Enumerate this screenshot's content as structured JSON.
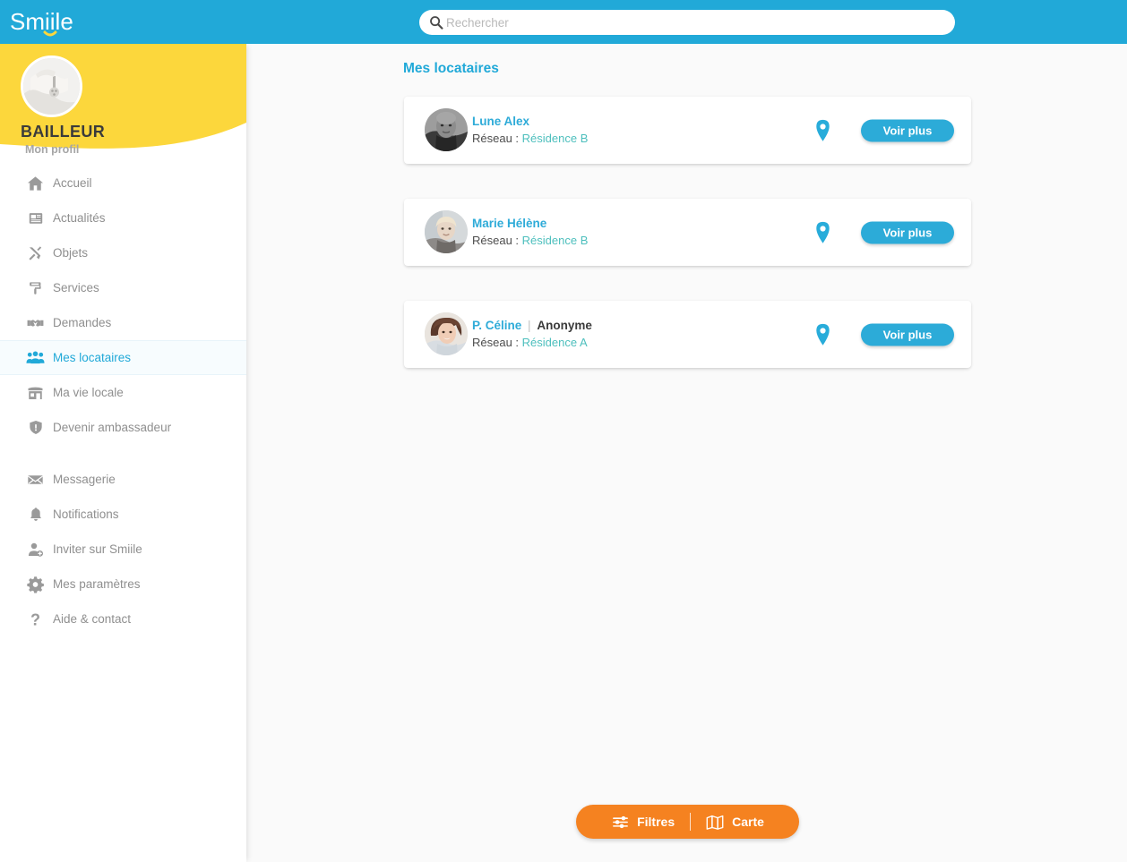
{
  "header": {
    "logo_text": "Smiile",
    "logo_icon": "smiile-logo",
    "search": {
      "placeholder": "Rechercher",
      "value": "",
      "icon": "search-icon"
    },
    "bg_color": "#21a9d8"
  },
  "sidebar": {
    "profile": {
      "name": "BAILLEUR",
      "subtitle": "Mon profil",
      "avatar_icon": "avatar-hand-holding-keys",
      "banner_color": "#fcd73c"
    },
    "groups": [
      {
        "items": [
          {
            "label": "Accueil",
            "icon": "home-icon",
            "active": false
          },
          {
            "label": "Actualités",
            "icon": "newspaper-icon",
            "active": false
          },
          {
            "label": "Objets",
            "icon": "tools-icon",
            "active": false
          },
          {
            "label": "Services",
            "icon": "paint-roller-icon",
            "active": false
          },
          {
            "label": "Demandes",
            "icon": "handshake-icon",
            "active": false
          },
          {
            "label": "Mes locataires",
            "icon": "users-icon",
            "active": true
          },
          {
            "label": "Ma vie locale",
            "icon": "storefront-icon",
            "active": false
          },
          {
            "label": "Devenir ambassadeur",
            "icon": "shield-icon",
            "active": false
          }
        ]
      },
      {
        "items": [
          {
            "label": "Messagerie",
            "icon": "envelope-icon",
            "active": false
          },
          {
            "label": "Notifications",
            "icon": "bell-icon",
            "active": false
          },
          {
            "label": "Inviter sur Smiile",
            "icon": "user-plus-icon",
            "active": false
          },
          {
            "label": "Mes paramètres",
            "icon": "gear-icon",
            "active": false
          },
          {
            "label": "Aide & contact",
            "icon": "question-mark-icon",
            "active": false
          }
        ]
      }
    ],
    "active_color": "#21a9d8",
    "inactive_color": "#8f8f8f"
  },
  "main": {
    "page_title": "Mes locataires",
    "network_label": "Réseau :",
    "pin_icon": "map-pin-icon",
    "more_label": "Voir plus",
    "tenants": [
      {
        "name": "Lune Alex",
        "anonymous_label": "",
        "separator": "",
        "network": "Résidence B",
        "avatar_icon": "avatar-man-photo"
      },
      {
        "name": "Marie Hélène",
        "anonymous_label": "",
        "separator": "",
        "network": "Résidence B",
        "avatar_icon": "avatar-woman-blonde-photo"
      },
      {
        "name": "P. Céline",
        "anonymous_label": "Anonyme",
        "separator": "|",
        "network": "Résidence A",
        "avatar_icon": "avatar-woman-brunette-photo"
      }
    ]
  },
  "bottom_bar": {
    "filters_label": "Filtres",
    "filters_icon": "sliders-icon",
    "map_label": "Carte",
    "map_icon": "map-icon",
    "bg_color": "#f58220"
  }
}
